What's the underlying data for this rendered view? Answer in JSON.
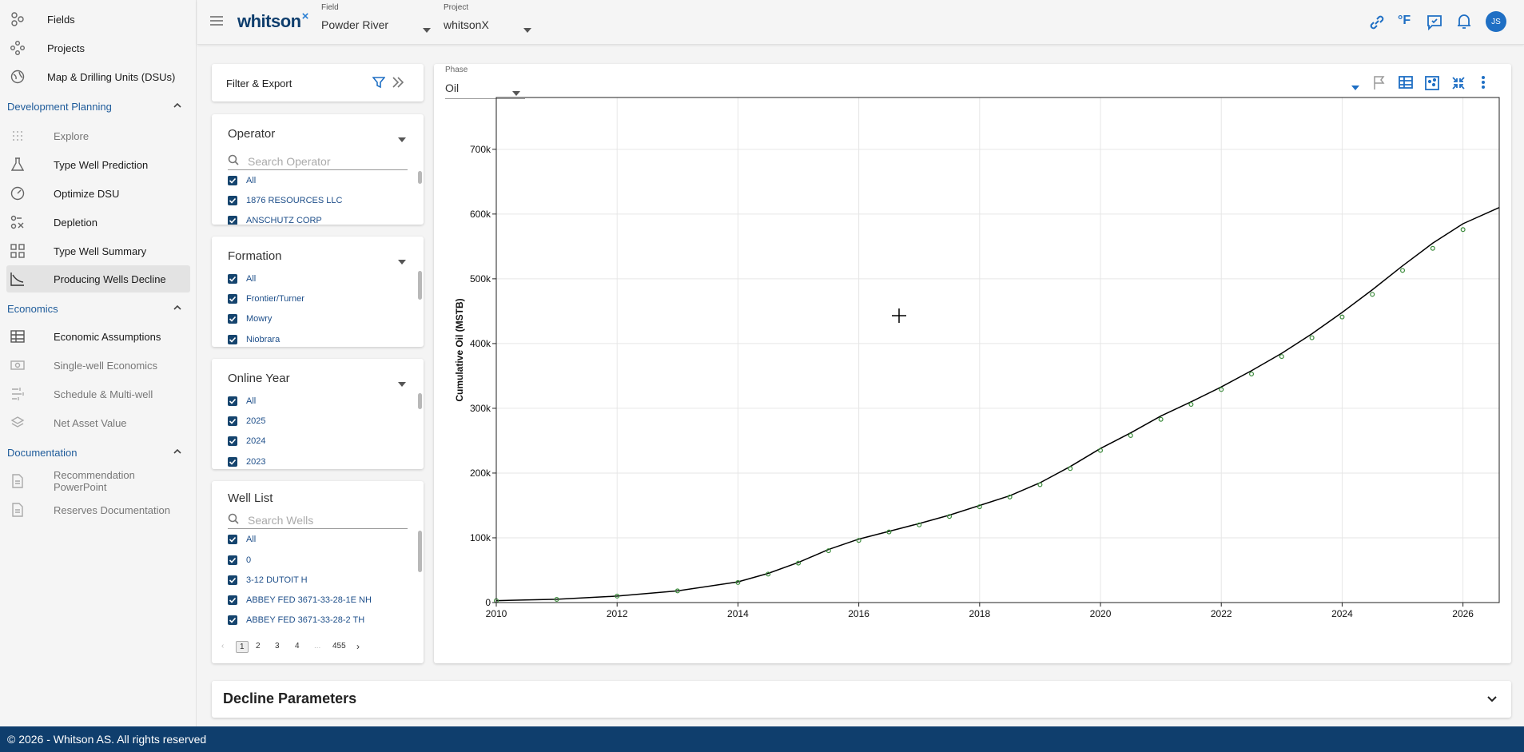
{
  "sidebar": {
    "top_items": [
      {
        "label": "Fields",
        "icon": "fields-icon"
      },
      {
        "label": "Projects",
        "icon": "projects-icon"
      },
      {
        "label": "Map & Drilling Units (DSUs)",
        "icon": "globe-icon"
      }
    ],
    "sections": [
      {
        "title": "Development Planning",
        "items": [
          {
            "label": "Explore",
            "icon": "dots-grid-icon"
          },
          {
            "label": "Type Well Prediction",
            "icon": "flask-icon"
          },
          {
            "label": "Optimize DSU",
            "icon": "gauge-icon"
          },
          {
            "label": "Depletion",
            "icon": "depletion-icon"
          },
          {
            "label": "Type Well Summary",
            "icon": "grid-icon"
          },
          {
            "label": "Producing Wells Decline",
            "icon": "decline-chart-icon"
          }
        ]
      },
      {
        "title": "Economics",
        "items": [
          {
            "label": "Economic Assumptions",
            "icon": "table-icon"
          },
          {
            "label": "Single-well Economics",
            "icon": "money-icon"
          },
          {
            "label": "Schedule & Multi-well",
            "icon": "schedule-icon"
          },
          {
            "label": "Net Asset Value",
            "icon": "layers-icon"
          }
        ]
      },
      {
        "title": "Documentation",
        "items": [
          {
            "label": "Recommendation PowerPoint",
            "icon": "document-icon"
          },
          {
            "label": "Reserves Documentation",
            "icon": "document-icon"
          }
        ]
      }
    ]
  },
  "header": {
    "logo_text": "whitson",
    "logo_mark": "×",
    "field_label": "Field",
    "field_value": "Powder River",
    "project_label": "Project",
    "project_value": "whitsonX",
    "unit_toggle": "°F",
    "avatar_initials": "JS"
  },
  "filter_panel": {
    "title": "Filter & Export",
    "operator": {
      "title": "Operator",
      "placeholder": "Search Operator",
      "items": [
        "All",
        "1876 RESOURCES LLC",
        "ANSCHUTZ CORP"
      ]
    },
    "formation": {
      "title": "Formation",
      "items": [
        "All",
        "Frontier/Turner",
        "Mowry",
        "Niobrara"
      ]
    },
    "online_year": {
      "title": "Online Year",
      "items": [
        "All",
        "2025",
        "2024",
        "2023"
      ]
    },
    "well_list": {
      "title": "Well List",
      "placeholder": "Search Wells",
      "items": [
        "All",
        "0",
        "3-12 DUTOIT H",
        "ABBEY FED 3671-33-28-1E NH",
        "ABBEY FED 3671-33-28-2 TH"
      ],
      "pages": [
        "1",
        "2",
        "3",
        "4",
        "...",
        "455"
      ],
      "current_page": "1"
    }
  },
  "chart_panel": {
    "phase_label": "Phase",
    "phase_value": "Oil"
  },
  "chart_data": {
    "type": "line",
    "title": "",
    "xlabel": "",
    "ylabel": "Cumulative Oil (MSTB)",
    "xlim": [
      2010,
      2026.6
    ],
    "ylim": [
      0,
      780000
    ],
    "x_ticks": [
      "2010",
      "2012",
      "2014",
      "2016",
      "2018",
      "2020",
      "2022",
      "2024",
      "2026"
    ],
    "y_ticks": [
      "0",
      "100k",
      "200k",
      "300k",
      "400k",
      "500k",
      "600k",
      "700k"
    ],
    "grid": true,
    "series": [
      {
        "kind": "line",
        "color": "#000000",
        "x": [
          2010,
          2011,
          2012,
          2013,
          2014,
          2014.5,
          2015,
          2015.5,
          2016,
          2016.5,
          2017,
          2017.5,
          2018,
          2018.5,
          2019,
          2019.5,
          2020,
          2020.5,
          2021,
          2021.5,
          2022,
          2022.5,
          2023,
          2023.5,
          2024,
          2024.5,
          2025,
          2025.5,
          2026,
          2026.6
        ],
        "y": [
          3000,
          5000,
          10000,
          18000,
          32000,
          45000,
          62000,
          82000,
          98000,
          110000,
          122000,
          135000,
          150000,
          165000,
          185000,
          210000,
          238000,
          262000,
          288000,
          310000,
          333000,
          358000,
          385000,
          415000,
          448000,
          483000,
          520000,
          555000,
          585000,
          610000
        ]
      },
      {
        "kind": "scatter",
        "color": "#3a8a3a",
        "x": [
          2010,
          2011,
          2012,
          2013,
          2014,
          2014.5,
          2015,
          2015.5,
          2016,
          2016.5,
          2017,
          2017.5,
          2018,
          2018.5,
          2019,
          2019.5,
          2020,
          2020.5,
          2021,
          2021.5,
          2022,
          2022.5,
          2023,
          2023.5,
          2024,
          2024.5,
          2025,
          2025.5,
          2026
        ],
        "y": [
          3000,
          5000,
          10000,
          18000,
          31000,
          44000,
          61000,
          80000,
          96000,
          109000,
          120000,
          133000,
          148000,
          163000,
          182000,
          207000,
          235000,
          258000,
          283000,
          306000,
          329000,
          353000,
          380000,
          409000,
          441000,
          476000,
          513000,
          547000,
          576000
        ]
      }
    ]
  },
  "decline_parameters": {
    "title": "Decline Parameters"
  },
  "footer": {
    "text": "© 2026 - Whitson AS. All rights reserved"
  },
  "colors": {
    "brand_navy": "#0f3e6d",
    "accent_blue": "#1f6fc4",
    "checkbox": "#15446e"
  }
}
